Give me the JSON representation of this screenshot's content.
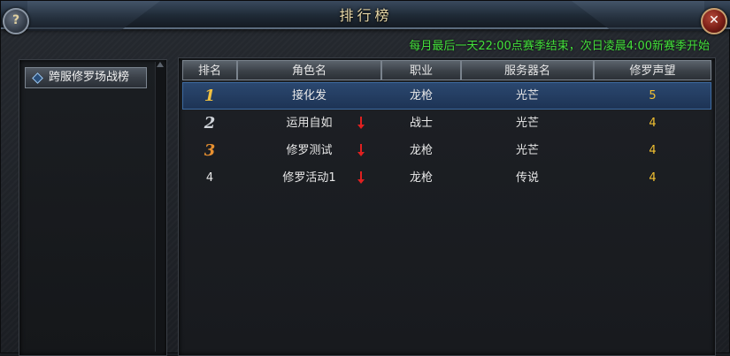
{
  "window": {
    "title": "排行榜",
    "help_label": "?",
    "close_label": "✕"
  },
  "notice": "每月最后一天22:00点赛季结束，次日凌晨4:00新赛季开始",
  "sidebar": {
    "items": [
      {
        "label": "跨服修罗场战榜",
        "icon": "diamond-icon"
      }
    ]
  },
  "table": {
    "headers": [
      "排名",
      "角色名",
      "职业",
      "服务器名",
      "修罗声望"
    ],
    "rows": [
      {
        "rank": "1",
        "name": "接化发",
        "class": "龙枪",
        "server": "光芒",
        "score": "5",
        "trend": ""
      },
      {
        "rank": "2",
        "name": "运用自如",
        "class": "战士",
        "server": "光芒",
        "score": "4",
        "trend": "down-arrow-icon"
      },
      {
        "rank": "3",
        "name": "修罗测试",
        "class": "龙枪",
        "server": "光芒",
        "score": "4",
        "trend": "down-arrow-icon"
      },
      {
        "rank": "4",
        "name": "修罗活动1",
        "class": "龙枪",
        "server": "传说",
        "score": "4",
        "trend": "down-arrow-icon"
      }
    ]
  },
  "colors": {
    "notice": "#44e03c",
    "score": "#f2c031",
    "selected_row": "#2b4870",
    "trend_down": "#e02020"
  }
}
